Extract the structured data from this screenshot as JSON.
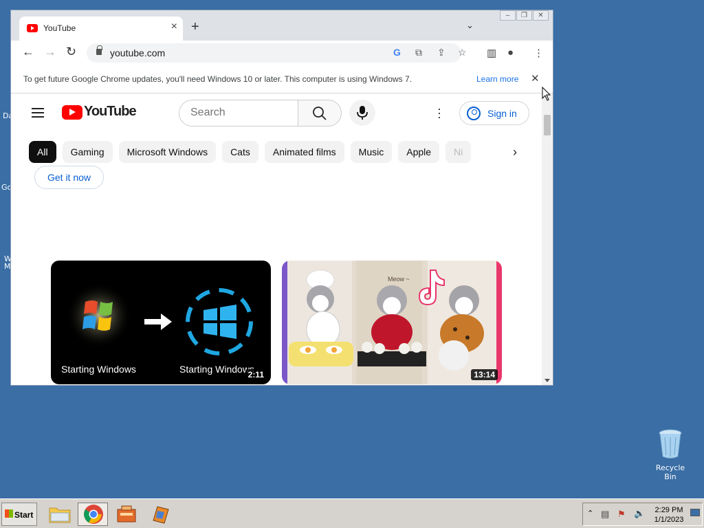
{
  "desktop": {
    "left_fragments": [
      "Da",
      "Go",
      "W",
      "M"
    ],
    "recycle_bin_label": "Recycle Bin"
  },
  "browser": {
    "tab_title": "YouTube",
    "url": "youtube.com",
    "infobar": {
      "message": "To get future Google Chrome updates, you'll need Windows 10 or later. This computer is using Windows 7.",
      "learn_more": "Learn more"
    }
  },
  "youtube": {
    "logo_text": "YouTube",
    "search_placeholder": "Search",
    "sign_in": "Sign in",
    "chips": [
      "All",
      "Gaming",
      "Microsoft Windows",
      "Cats",
      "Animated films",
      "Music",
      "Apple",
      "Ni"
    ],
    "promo_button": "Get it now",
    "videos": [
      {
        "caption_left": "Starting Windows",
        "caption_right": "Starting Windows",
        "duration": "2:11"
      },
      {
        "meow_text": "Meow ~",
        "duration": "13:14"
      }
    ]
  },
  "taskbar": {
    "start_label": "Start",
    "time": "2:29 PM",
    "date": "1/1/2023"
  }
}
